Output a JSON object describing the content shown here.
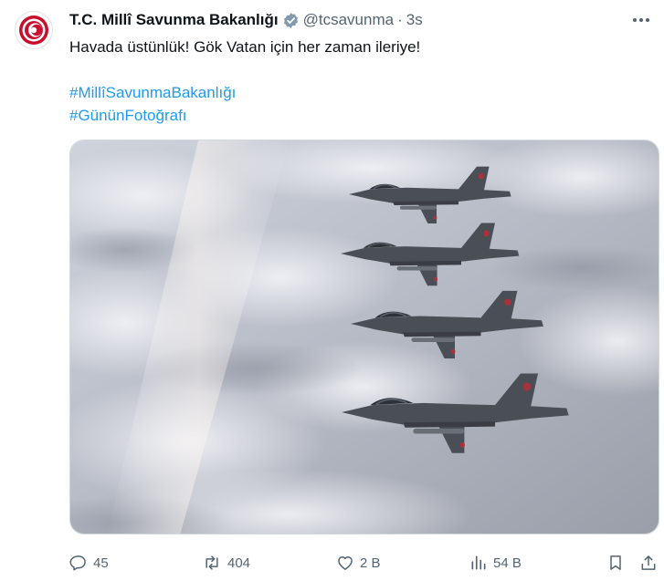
{
  "account": {
    "name": "T.C. Millî Savunma Bakanlığı",
    "handle": "@tcsavunma",
    "separator": "·",
    "time": "3s"
  },
  "tweet": {
    "text": "Havada üstünlük! Gök Vatan için her zaman ileriye!",
    "hashtags": [
      "#MillîSavunmaBakanlığı",
      "#GününFotoğrafı"
    ]
  },
  "actions": {
    "reply_count": "45",
    "retweet_count": "404",
    "like_count": "2 B",
    "view_count": "54 B"
  },
  "icons": {
    "verified": "verified-badge-icon",
    "more": "more-icon",
    "reply": "reply-icon",
    "retweet": "retweet-icon",
    "like": "heart-icon",
    "views": "views-icon",
    "bookmark": "bookmark-icon",
    "share": "share-icon"
  },
  "colors": {
    "accent": "#1d9bf0",
    "muted": "#536471",
    "emblem": "#c8102e",
    "verified_badge": "#829aab"
  }
}
